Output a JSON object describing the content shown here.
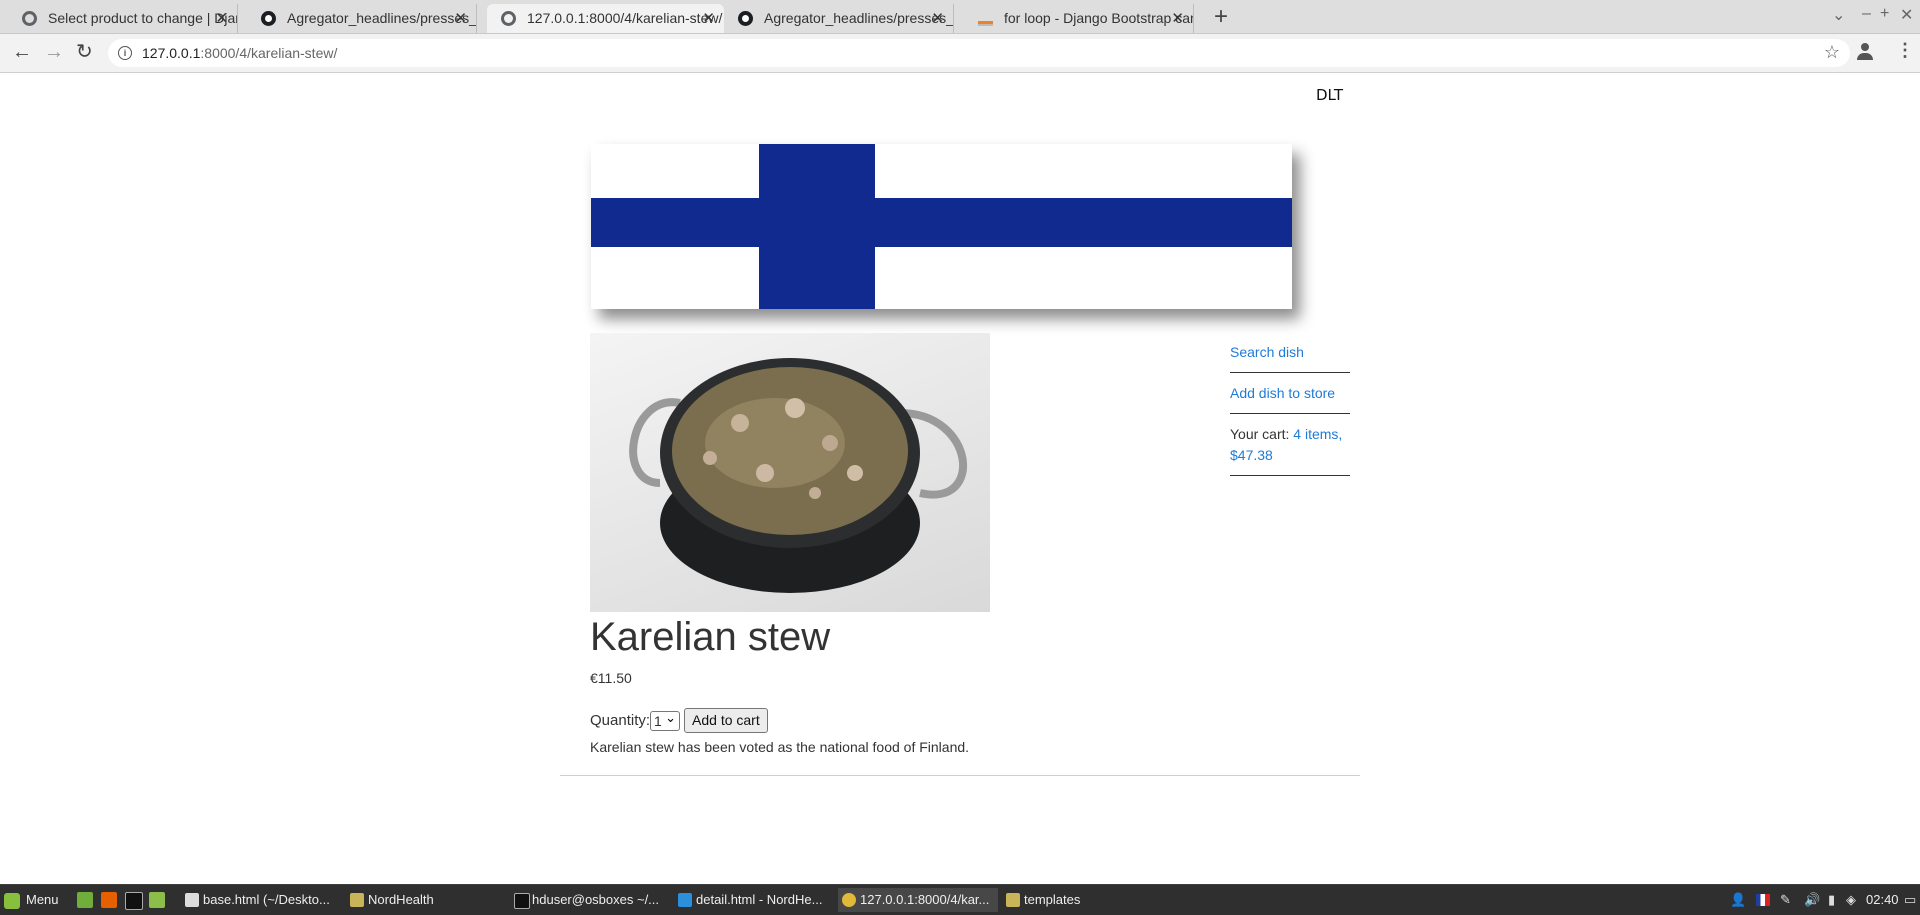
{
  "browser": {
    "tabs": [
      {
        "title": "Select product to change | Django site admin",
        "icon": "globe-icon",
        "active": false
      },
      {
        "title": "Agregator_headlines/presses_headlines",
        "icon": "github-icon",
        "active": false
      },
      {
        "title": "127.0.0.1:8000/4/karelian-stew/",
        "icon": "globe-icon",
        "active": true
      },
      {
        "title": "Agregator_headlines/presses_headlines",
        "icon": "github-icon",
        "active": false
      },
      {
        "title": "for loop - Django Bootstrap cards",
        "icon": "stackoverflow-icon",
        "active": false
      }
    ],
    "new_tab_label": "+",
    "url_host": "127.0.0.1",
    "url_rest": ":8000/4/karelian-stew/"
  },
  "page": {
    "top_nav": "DLT",
    "hero_alt": "Finnish flag banner",
    "dish_image_alt": "Karelian stew in a pot",
    "product": {
      "title": "Karelian stew",
      "price": "€11.50",
      "quantity_label": "Quantity:",
      "quantity_value": "1",
      "add_button": "Add to cart",
      "description": "Karelian stew has been voted as the national food of Finland."
    },
    "sidebar": {
      "search_link": "Search dish",
      "add_link": "Add dish to store",
      "cart_label": "Your cart:",
      "cart_summary": "4 items, $47.38"
    },
    "colors": {
      "flag_blue": "#102a8f",
      "link_blue": "#1e7bd8"
    }
  },
  "taskbar": {
    "menu_label": "Menu",
    "tasks": [
      {
        "label": "base.html (~/Deskto...",
        "active": false
      },
      {
        "label": "NordHealth",
        "active": false
      },
      {
        "label": "hduser@osboxes ~/...",
        "active": false
      },
      {
        "label": "detail.html - NordHe...",
        "active": false
      },
      {
        "label": "127.0.0.1:8000/4/kar...",
        "active": true
      },
      {
        "label": "templates",
        "active": false
      }
    ],
    "clock": "02:40"
  }
}
